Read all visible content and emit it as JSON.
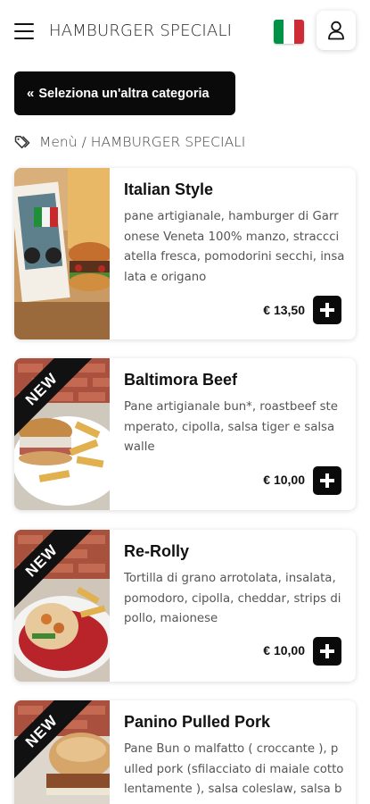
{
  "header": {
    "title": "HAMBURGER SPECIALI",
    "flag_colors": [
      "#009246",
      "#ffffff",
      "#ce2b37"
    ]
  },
  "nav": {
    "category_button": "Seleziona un'altra categoria",
    "category_button_icon": "chevrons-left-icon"
  },
  "breadcrumb": {
    "root": "Menù",
    "separator": "/",
    "current": "HAMBURGER SPECIALI"
  },
  "theme": {
    "accent": "#0a0a0a",
    "card_bg": "#ffffff",
    "text_muted": "#555555"
  },
  "products": [
    {
      "name": "Italian Style",
      "description": "pane artigianale, hamburger di Garronese Veneta 100% manzo, straccciatella fresca, pomodorini secchi, insalata e origano",
      "price": "€ 13,50",
      "badge": ""
    },
    {
      "name": "Baltimora Beef",
      "description": "Pane artigianale bun*, roastbeef stemperato, cipolla, salsa tiger e salsa walle",
      "price": "€ 10,00",
      "badge": "NEW"
    },
    {
      "name": "Re-Rolly",
      "description": "Tortilla di grano arrotolata, insalata, pomodoro, cipolla, cheddar, strips di pollo, maionese",
      "price": "€ 10,00",
      "badge": "NEW"
    },
    {
      "name": "Panino Pulled Pork",
      "description": "Pane Bun o malfatto ( croccante ), pulled pork (sfilacciato di maiale cotto lentamente ), salsa coleslaw, salsa barbecue",
      "price": "",
      "badge": "NEW"
    }
  ]
}
